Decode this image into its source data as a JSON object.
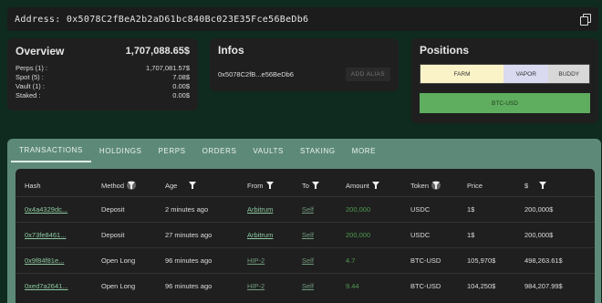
{
  "address_bar": {
    "label": "Address:",
    "address": "0x5078C2fBeA2b2aD61bc840Bc023E35Fce56BeDb6"
  },
  "overview": {
    "title": "Overview",
    "total": "1,707,088.65$",
    "rows": [
      {
        "label": "Perps (1) :",
        "value": "1,707,081.57$"
      },
      {
        "label": "Spot (5) :",
        "value": "7.08$"
      },
      {
        "label": "Vault (1) :",
        "value": "0.00$"
      },
      {
        "label": "Staked :",
        "value": "0.00$"
      }
    ]
  },
  "infos": {
    "title": "Infos",
    "short_address": "0x5078C2fB...e56BeDb6",
    "add_alias": "ADD ALIAS"
  },
  "positions": {
    "title": "Positions",
    "segments": [
      {
        "label": "FARM",
        "color": "#fbf3c8"
      },
      {
        "label": "VAPOR",
        "color": "#d9d9f0"
      },
      {
        "label": "BUDDY",
        "color": "#d8d8d8"
      }
    ],
    "asset": "BTC-USD"
  },
  "tabs": [
    "TRANSACTIONS",
    "HOLDINGS",
    "PERPS",
    "ORDERS",
    "VAULTS",
    "STAKING",
    "MORE"
  ],
  "table": {
    "headers": [
      "Hash",
      "Method",
      "Age",
      "From",
      "To",
      "Amount",
      "Token",
      "Price",
      "$"
    ],
    "rows": [
      {
        "hash": "0x4a4329dc...",
        "method": "Deposit",
        "age": "2 minutes ago",
        "from": "Arbitrum",
        "to": "Self",
        "amount": "200,000",
        "token": "USDC",
        "price": "1$",
        "usd": "200,000$"
      },
      {
        "hash": "0x73fe8461...",
        "method": "Deposit",
        "age": "27 minutes ago",
        "from": "Arbitrum",
        "to": "Self",
        "amount": "200,000",
        "token": "USDC",
        "price": "1$",
        "usd": "200,000$"
      },
      {
        "hash": "0x9f84f81e...",
        "method": "Open Long",
        "age": "96 minutes ago",
        "from": "HIP-2",
        "to": "Self",
        "amount": "4.7",
        "token": "BTC-USD",
        "price": "105,970$",
        "usd": "498,263.61$"
      },
      {
        "hash": "0xed7a2641...",
        "method": "Open Long",
        "age": "96 minutes ago",
        "from": "HIP-2",
        "to": "Self",
        "amount": "9.44",
        "token": "BTC-USD",
        "price": "104,250$",
        "usd": "984,207.99$"
      }
    ]
  },
  "colors": {
    "background": "#0f2a1e",
    "card": "#1f1f1f",
    "tab_bar": "#5d8a78",
    "green_amount": "#4f9a4f",
    "link": "#8cc8a0"
  }
}
